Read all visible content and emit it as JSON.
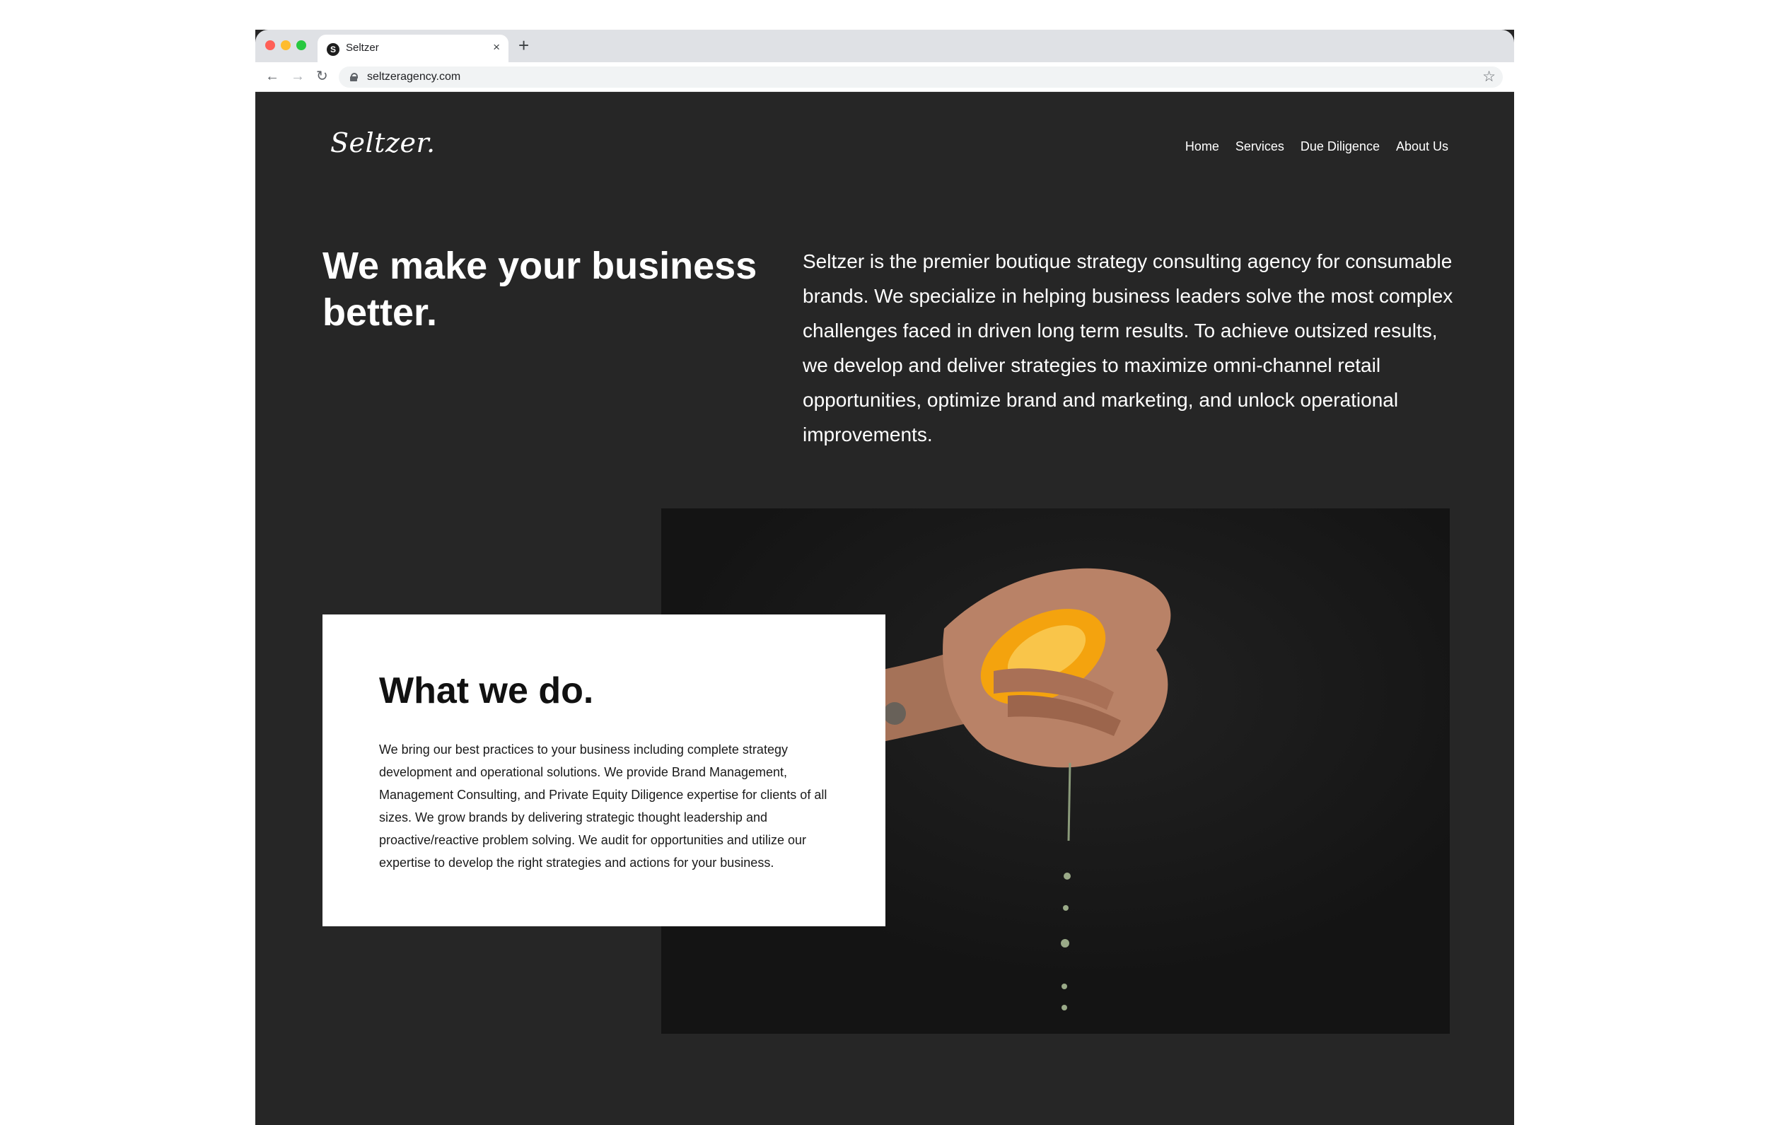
{
  "browser": {
    "tab_title": "Seltzer",
    "tab_favicon_letter": "S",
    "tab_close": "×",
    "new_tab": "+",
    "url": "seltzeragency.com"
  },
  "site": {
    "logo": "Seltzer.",
    "nav": [
      {
        "label": "Home"
      },
      {
        "label": "Services"
      },
      {
        "label": "Due Diligence"
      },
      {
        "label": "About Us"
      }
    ]
  },
  "hero": {
    "headline": "We make your business better.",
    "intro": "Seltzer is the premier boutique strategy consulting agency for consumable brands. We specialize in helping business leaders solve the most complex challenges faced in driven long term results. To achieve outsized results, we develop and deliver strategies to maximize omni-channel retail opportunities, optimize brand and marketing, and unlock operational improvements."
  },
  "what_we_do": {
    "title": "What we do.",
    "body": "We bring our best practices to your business including complete strategy development and operational solutions. We provide Brand Management, Management Consulting, and Private Equity Diligence expertise for clients of all sizes. We grow brands by delivering strategic thought leadership and proactive/reactive problem solving.  We audit for opportunities and utilize our expertise to develop the right strategies and actions for your business."
  },
  "icons": {
    "back": "arrow-left-icon",
    "forward": "arrow-right-icon",
    "reload": "reload-icon",
    "secure": "lock-icon",
    "bookmark": "star-icon"
  },
  "colors": {
    "page_background": "#262626",
    "photo_background": "#161616",
    "card_background": "#ffffff",
    "orange": "#f4a30e"
  }
}
